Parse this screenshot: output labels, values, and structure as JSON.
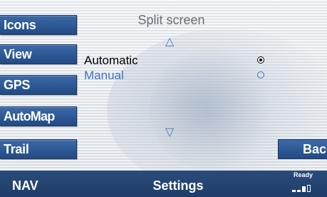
{
  "header": {
    "title": "Split screen"
  },
  "softkeys": {
    "icons": "Icons",
    "view": "View",
    "gps": "GPS",
    "automap": "AutoMap",
    "trail": "Trail",
    "back": "Back"
  },
  "options": [
    {
      "label": "Automatic",
      "selected": true
    },
    {
      "label": "Manual",
      "selected": false
    }
  ],
  "navigation": {
    "up_icon": "triangle-up-icon",
    "down_icon": "triangle-down-icon"
  },
  "statusbar": {
    "mode": "NAV",
    "screen": "Settings",
    "status": "Ready",
    "status_icon": "signal-bars-icon"
  },
  "colors": {
    "softkey": "#2c5895",
    "statusbar": "#1f3d68",
    "selected_text": "#000000",
    "unselected_text": "#3f74c2",
    "title_text": "#6b7078"
  }
}
